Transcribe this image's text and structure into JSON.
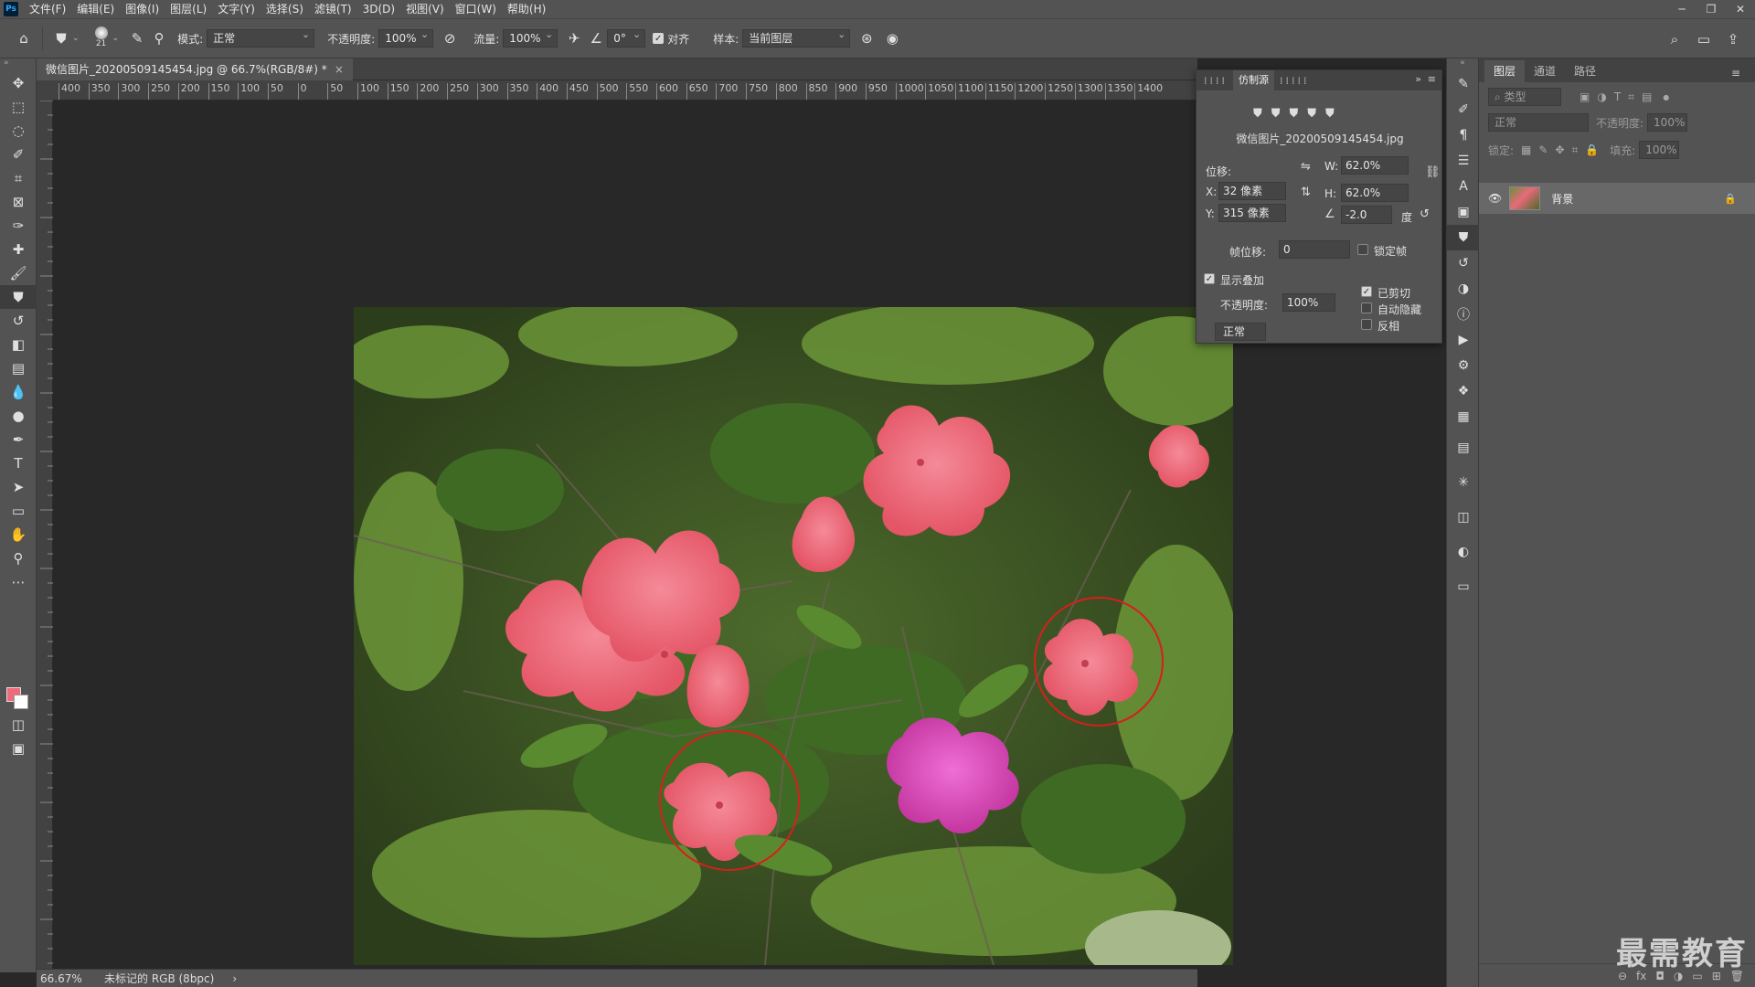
{
  "app": {
    "logo": "Ps"
  },
  "menu": [
    "文件(F)",
    "编辑(E)",
    "图像(I)",
    "图层(L)",
    "文字(Y)",
    "选择(S)",
    "滤镜(T)",
    "3D(D)",
    "视图(V)",
    "窗口(W)",
    "帮助(H)"
  ],
  "options": {
    "brush_size": "21",
    "mode_label": "模式:",
    "mode_value": "正常",
    "opacity_label": "不透明度:",
    "opacity_value": "100%",
    "flow_label": "流量:",
    "flow_value": "100%",
    "angle_value": "0°",
    "aligned_label": "对齐",
    "sample_label": "样本:",
    "sample_value": "当前图层"
  },
  "document": {
    "tab_title": "微信图片_20200509145454.jpg @ 66.7%(RGB/8#) *",
    "close": "×"
  },
  "ruler": {
    "h_ticks": [
      "400",
      "350",
      "300",
      "250",
      "200",
      "150",
      "100",
      "50",
      "0",
      "50",
      "100",
      "150",
      "200",
      "250",
      "300",
      "350",
      "400",
      "450",
      "500",
      "550",
      "600",
      "650",
      "700",
      "750",
      "800",
      "850",
      "900",
      "950",
      "1000",
      "1050",
      "1100",
      "1150",
      "1200",
      "1250",
      "1300",
      "1350",
      "1400"
    ]
  },
  "status": {
    "zoom": "66.67%",
    "profile": "未标记的 RGB (8bpc)",
    "arrow": "›"
  },
  "clone_source": {
    "tab": "仿制源",
    "filename": "微信图片_20200509145454.jpg",
    "offset_label": "位移:",
    "w_label": "W:",
    "w_value": "62.0%",
    "h_label": "H:",
    "h_value": "62.0%",
    "x_label": "X:",
    "x_value": "32 像素",
    "y_label": "Y:",
    "y_value": "315 像素",
    "angle_value": "-2.0",
    "degree_label": "度",
    "frame_offset_label": "帧位移:",
    "frame_offset_value": "0",
    "lock_frame_label": "锁定帧",
    "show_overlay_label": "显示叠加",
    "overlay_opacity_label": "不透明度:",
    "overlay_opacity_value": "100%",
    "clipped_label": "已剪切",
    "auto_hide_label": "自动隐藏",
    "invert_label": "反相",
    "blend_value": "正常"
  },
  "layers_panel": {
    "tabs": [
      "图层",
      "通道",
      "路径"
    ],
    "filter_placeholder": "类型",
    "blend_value": "正常",
    "opacity_label": "不透明度:",
    "opacity_value": "100%",
    "lock_label": "锁定:",
    "fill_label": "填充:",
    "fill_value": "100%",
    "layer_name": "背景",
    "bottom_icons": [
      "⊖",
      "fx"
    ]
  },
  "watermark": "最需教育",
  "colors": {
    "foreground": "#ef6a7c",
    "background": "#ffffff",
    "ui_panel": "#535353",
    "canvas_bg": "#282828"
  }
}
